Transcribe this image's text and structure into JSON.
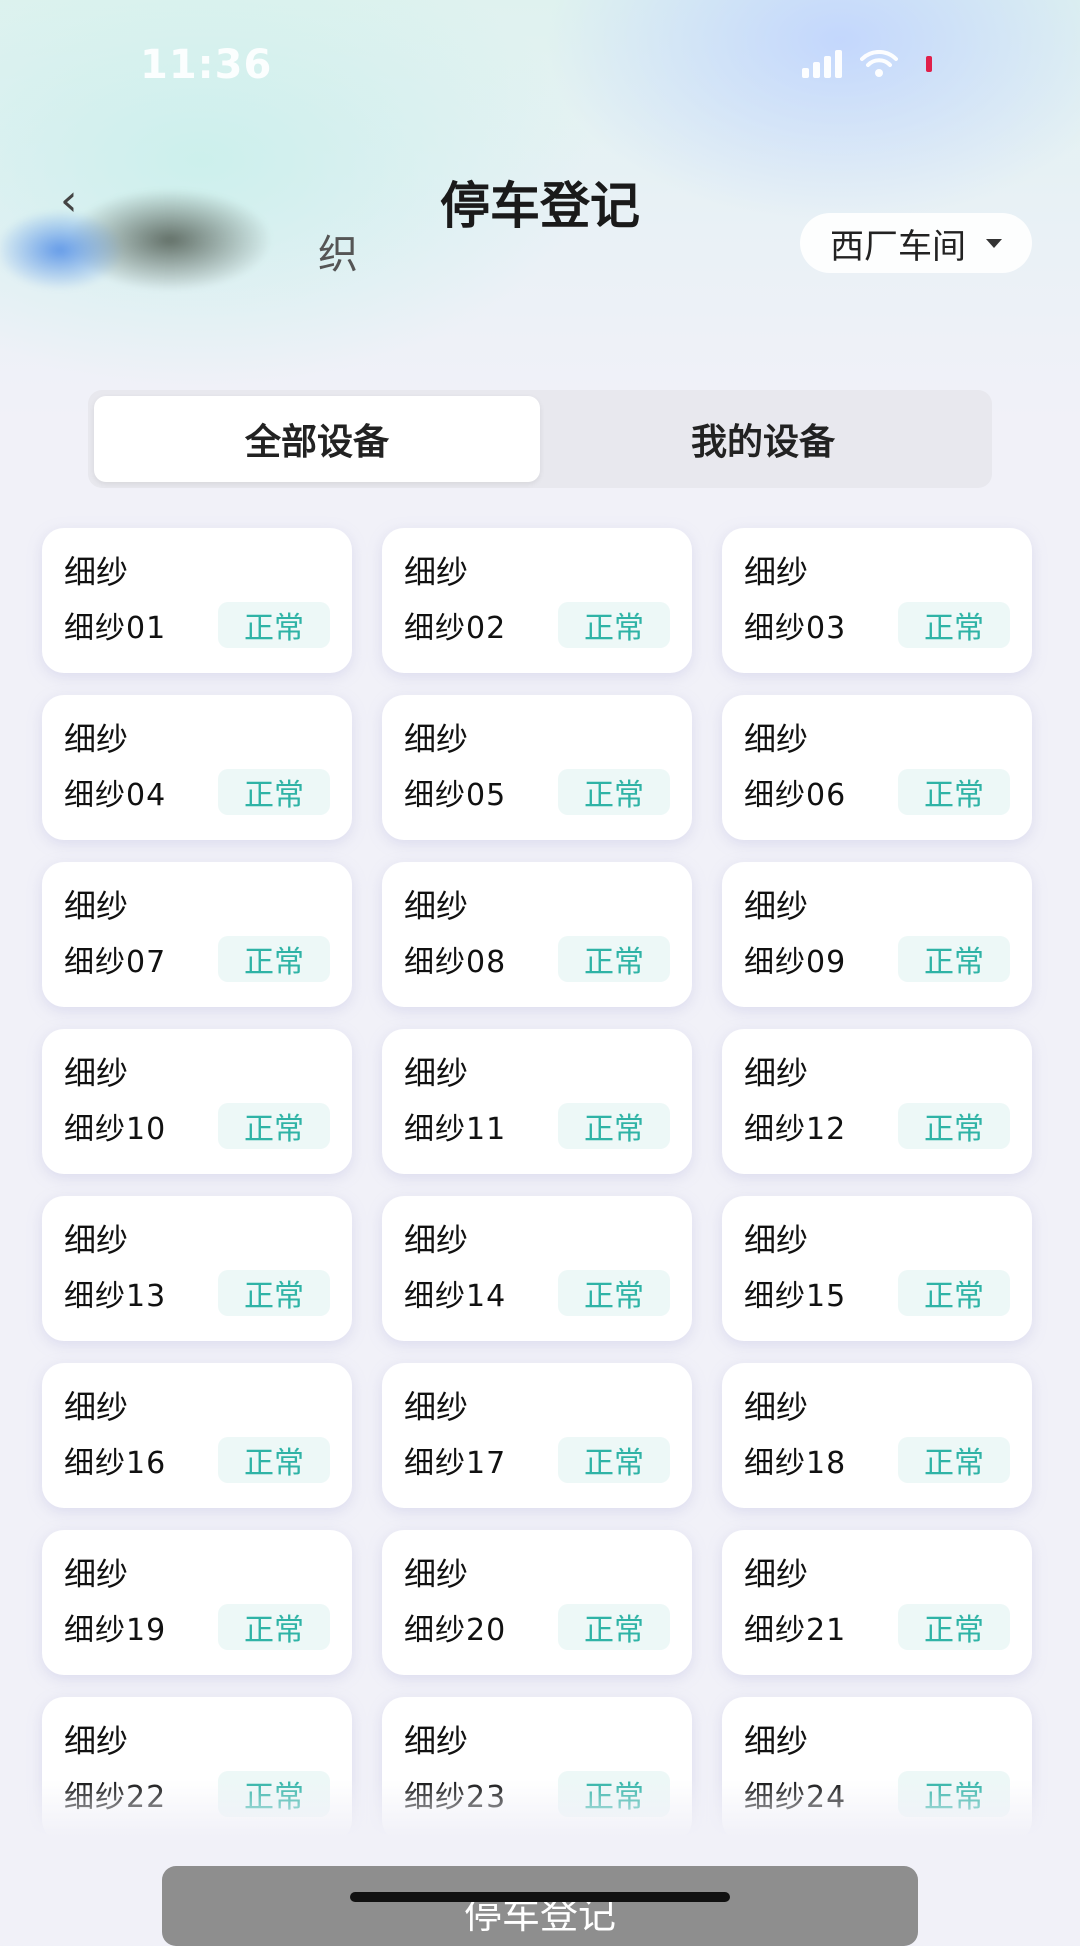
{
  "status_bar": {
    "time": "11:36",
    "icons": [
      "signal-icon",
      "wifi-icon",
      "battery-icon"
    ]
  },
  "header": {
    "back_icon": "chevron-left-icon",
    "factory_name_visible_char": "织",
    "title": "停车登记",
    "workshop": "西厂车间"
  },
  "tabs": [
    {
      "label": "全部设备",
      "active": true
    },
    {
      "label": "我的设备",
      "active": false
    }
  ],
  "devices": [
    {
      "type": "细纱",
      "name": "细纱01",
      "status": "正常"
    },
    {
      "type": "细纱",
      "name": "细纱02",
      "status": "正常"
    },
    {
      "type": "细纱",
      "name": "细纱03",
      "status": "正常"
    },
    {
      "type": "细纱",
      "name": "细纱04",
      "status": "正常"
    },
    {
      "type": "细纱",
      "name": "细纱05",
      "status": "正常"
    },
    {
      "type": "细纱",
      "name": "细纱06",
      "status": "正常"
    },
    {
      "type": "细纱",
      "name": "细纱07",
      "status": "正常"
    },
    {
      "type": "细纱",
      "name": "细纱08",
      "status": "正常"
    },
    {
      "type": "细纱",
      "name": "细纱09",
      "status": "正常"
    },
    {
      "type": "细纱",
      "name": "细纱10",
      "status": "正常"
    },
    {
      "type": "细纱",
      "name": "细纱11",
      "status": "正常"
    },
    {
      "type": "细纱",
      "name": "细纱12",
      "status": "正常"
    },
    {
      "type": "细纱",
      "name": "细纱13",
      "status": "正常"
    },
    {
      "type": "细纱",
      "name": "细纱14",
      "status": "正常"
    },
    {
      "type": "细纱",
      "name": "细纱15",
      "status": "正常"
    },
    {
      "type": "细纱",
      "name": "细纱16",
      "status": "正常"
    },
    {
      "type": "细纱",
      "name": "细纱17",
      "status": "正常"
    },
    {
      "type": "细纱",
      "name": "细纱18",
      "status": "正常"
    },
    {
      "type": "细纱",
      "name": "细纱19",
      "status": "正常"
    },
    {
      "type": "细纱",
      "name": "细纱20",
      "status": "正常"
    },
    {
      "type": "细纱",
      "name": "细纱21",
      "status": "正常"
    },
    {
      "type": "细纱",
      "name": "细纱22",
      "status": "正常"
    },
    {
      "type": "细纱",
      "name": "细纱23",
      "status": "正常"
    },
    {
      "type": "细纱",
      "name": "细纱24",
      "status": "正常"
    }
  ],
  "footer": {
    "register_button": "停车登记"
  },
  "colors": {
    "status_text": "#2fb3a6",
    "status_bg": "#edf8f7",
    "button_bg": "#8e8e8e"
  }
}
